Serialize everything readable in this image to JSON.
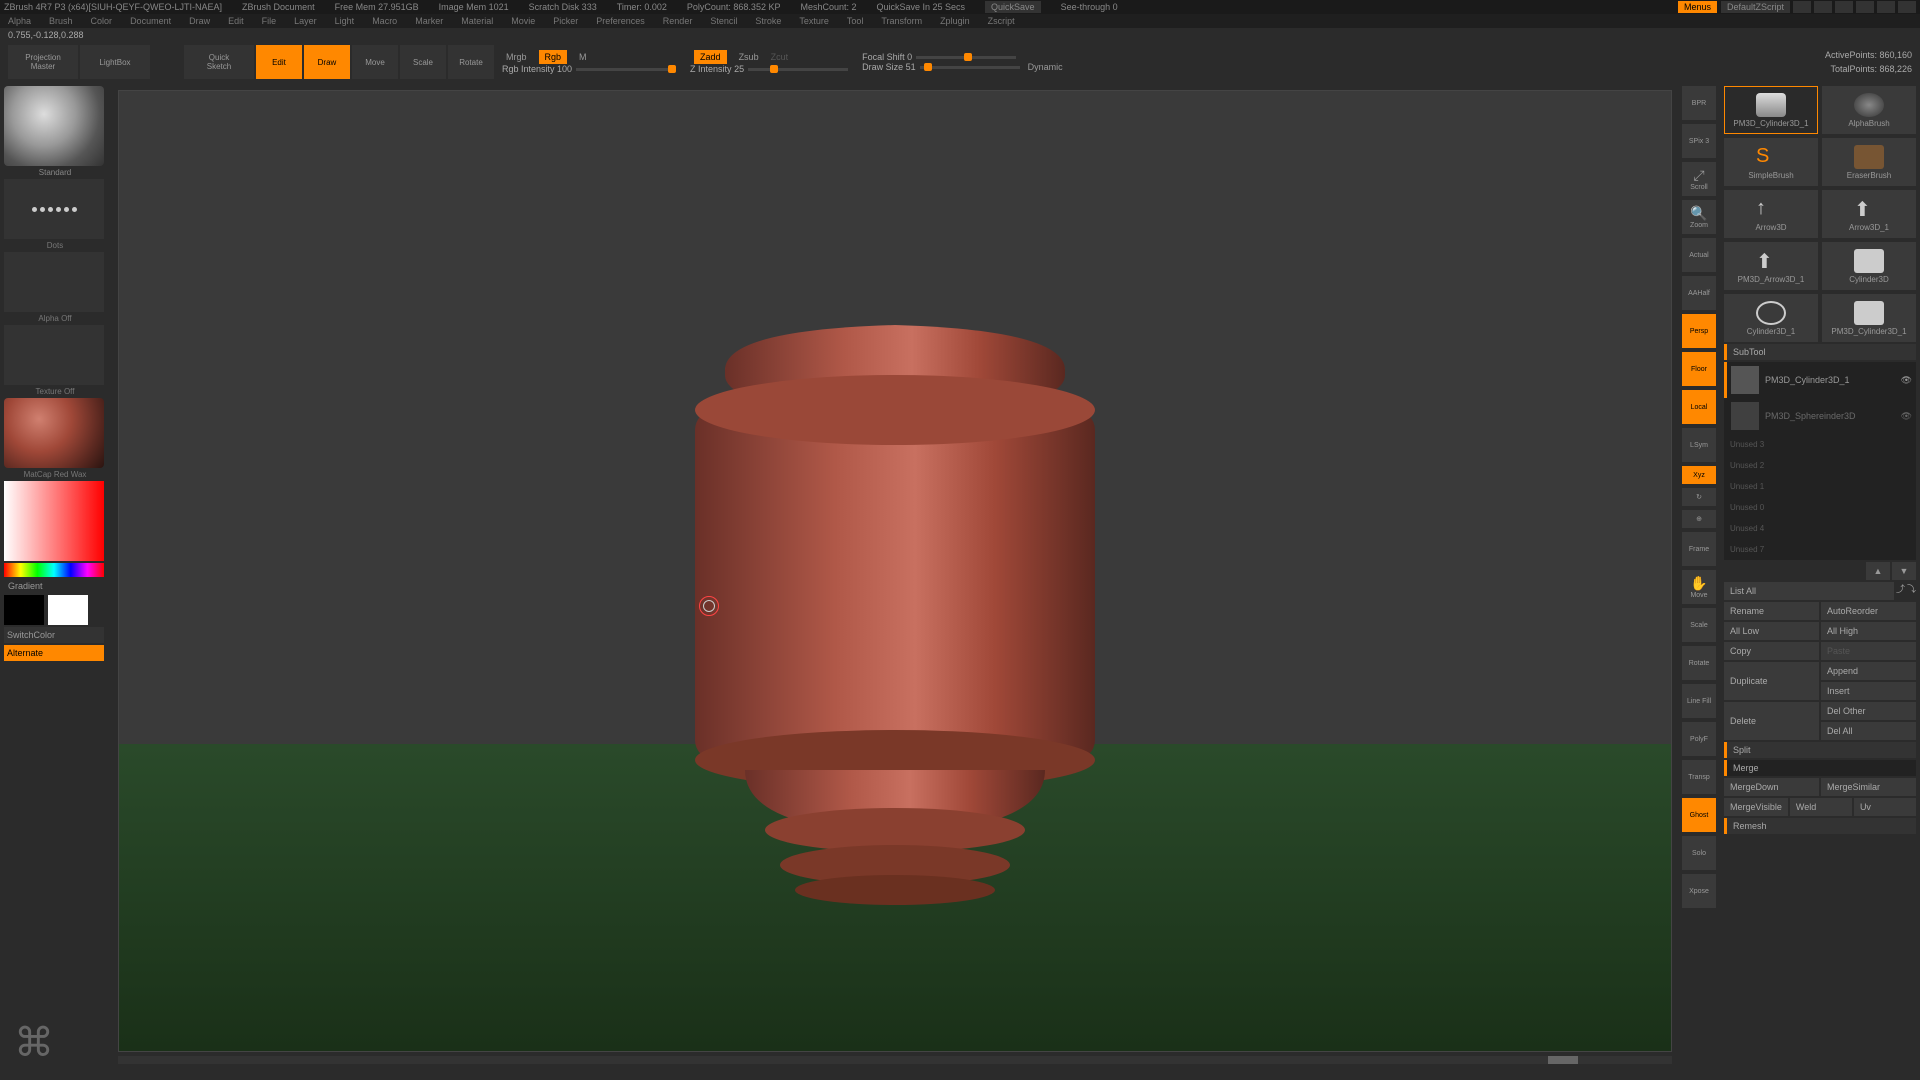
{
  "title_bar": {
    "app": "ZBrush 4R7 P3  (x64)[SIUH-QEYF-QWEO-LJTI-NAEA]",
    "doc": "ZBrush Document",
    "mem": "Free Mem 27.951GB",
    "img": "Image Mem 1021",
    "disk": "Scratch Disk 333",
    "timer": "Timer: 0.002",
    "poly": "PolyCount: 868.352 KP",
    "mesh": "MeshCount: 2",
    "quicksave_in": "QuickSave In 25 Secs",
    "quicksave": "QuickSave",
    "see": "See-through  0",
    "menus": "Menus",
    "script": "DefaultZScript"
  },
  "menus": [
    "Alpha",
    "Brush",
    "Color",
    "Document",
    "Draw",
    "Edit",
    "File",
    "Layer",
    "Light",
    "Macro",
    "Marker",
    "Material",
    "Movie",
    "Picker",
    "Preferences",
    "Render",
    "Stencil",
    "Stroke",
    "Texture",
    "Tool",
    "Transform",
    "Zplugin",
    "Zscript"
  ],
  "coords": "0.755,-0.128,0.288",
  "toolbar": {
    "projection": "Projection\nMaster",
    "lightbox": "LightBox",
    "quicksketch": "Quick\nSketch",
    "edit": "Edit",
    "draw": "Draw",
    "move": "Move",
    "scale": "Scale",
    "rotate": "Rotate",
    "mrgb": "Mrgb",
    "rgb": "Rgb",
    "m": "M",
    "zadd": "Zadd",
    "zsub": "Zsub",
    "zcut": "Zcut",
    "rgb_intensity": "Rgb Intensity 100",
    "z_intensity": "Z Intensity 25",
    "focal_shift": "Focal Shift 0",
    "draw_size": "Draw Size 51",
    "dynamic": "Dynamic",
    "active_points": "ActivePoints: 860,160",
    "total_points": "TotalPoints: 868,226"
  },
  "left": {
    "brush": "Standard",
    "stroke": "Dots",
    "alpha": "Alpha Off",
    "texture": "Texture Off",
    "material": "MatCap Red Wax",
    "gradient": "Gradient",
    "switchcolor": "SwitchColor",
    "alternate": "Alternate"
  },
  "right_tools": {
    "bpr": "BPR",
    "spix": "SPix 3",
    "scroll": "Scroll",
    "zoom": "Zoom",
    "actual": "Actual",
    "aahalf": "AAHalf",
    "persp": "Persp",
    "floor": "Floor",
    "local": "Local",
    "lsym": "LSym",
    "xyz": "Xyz",
    "frame": "Frame",
    "move": "Move",
    "scale": "Scale",
    "rotate": "Rotate",
    "linefill": "Line Fill",
    "polyf": "PolyF",
    "transp": "Transp",
    "ghost": "Ghost",
    "solo": "Solo",
    "xpose": "Xpose"
  },
  "tools": [
    {
      "name": "PM3D_Cylinder3D_1"
    },
    {
      "name": "AlphaBrush"
    },
    {
      "name": "SimpleBrush"
    },
    {
      "name": "EraserBrush"
    },
    {
      "name": "Arrow3D"
    },
    {
      "name": "Arrow3D_1"
    },
    {
      "name": "PM3D_Arrow3D_1"
    },
    {
      "name": "Cylinder3D"
    },
    {
      "name": "Cylinder3D_1"
    },
    {
      "name": "PM3D_Cylinder3D_1"
    }
  ],
  "subtool": {
    "header": "SubTool",
    "items": [
      {
        "name": "PM3D_Cylinder3D_1"
      },
      {
        "name": "PM3D_Sphereinder3D"
      }
    ],
    "empty": [
      "Unused 3",
      "Unused 2",
      "Unused 1",
      "Unused 0",
      "Unused 4",
      "Unused 7"
    ],
    "list_all": "List All",
    "rename": "Rename",
    "autoreorder": "AutoReorder",
    "all_low": "All Low",
    "all_high": "All High",
    "copy": "Copy",
    "paste": "Paste",
    "duplicate": "Duplicate",
    "append": "Append",
    "insert": "Insert",
    "delete": "Delete",
    "del_other": "Del Other",
    "del_all": "Del All",
    "split": "Split",
    "merge": "Merge",
    "mergedown": "MergeDown",
    "mergesimilar": "MergeSimilar",
    "mergevisible": "MergeVisible",
    "weld": "Weld",
    "uv": "Uv",
    "remesh": "Remesh"
  }
}
